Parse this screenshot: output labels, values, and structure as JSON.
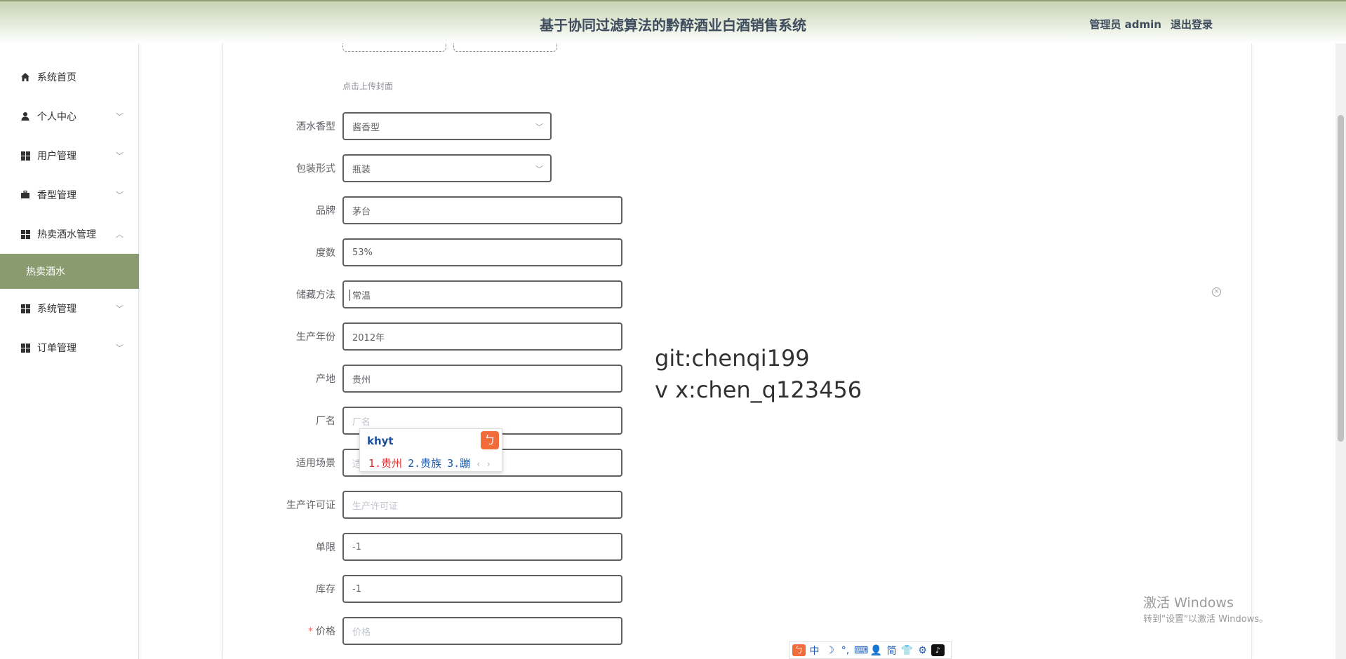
{
  "header": {
    "title": "基于协同过滤算法的黔醉酒业白酒销售系统",
    "user": "管理员 admin",
    "logout": "退出登录"
  },
  "sidebar": {
    "items": [
      {
        "label": "系统首页",
        "icon": "home-icon"
      },
      {
        "label": "个人中心",
        "icon": "user-icon",
        "arrow": "﹀"
      },
      {
        "label": "用户管理",
        "icon": "grid-icon",
        "arrow": "﹀"
      },
      {
        "label": "香型管理",
        "icon": "briefcase-icon",
        "arrow": "﹀"
      },
      {
        "label": "热卖酒水管理",
        "icon": "grid-icon",
        "arrow": "︿"
      },
      {
        "label": "系统管理",
        "icon": "grid-icon",
        "arrow": "﹀"
      },
      {
        "label": "订单管理",
        "icon": "grid-icon",
        "arrow": "﹀"
      }
    ],
    "active_sub": "热卖酒水"
  },
  "form": {
    "upload_hint": "点击上传封面",
    "fields": [
      {
        "label": "酒水香型",
        "value": "酱香型",
        "type": "select"
      },
      {
        "label": "包装形式",
        "value": "瓶装",
        "type": "select"
      },
      {
        "label": "品牌",
        "value": "茅台"
      },
      {
        "label": "度数",
        "value": "53%"
      },
      {
        "label": "储藏方法",
        "value": "常温"
      },
      {
        "label": "生产年份",
        "value": "2012年"
      },
      {
        "label": "产地",
        "value": "贵州"
      },
      {
        "label": "厂名",
        "placeholder": "厂名"
      },
      {
        "label": "适用场景",
        "placeholder": "适"
      },
      {
        "label": "生产许可证",
        "placeholder": "生产许可证"
      },
      {
        "label": "单限",
        "value": "-1"
      },
      {
        "label": "库存",
        "value": "-1"
      },
      {
        "label": "价格",
        "placeholder": "价格",
        "required": "*"
      }
    ]
  },
  "watermark": {
    "line1": "git:chenqi199",
    "line2": "v x:chen_q123456"
  },
  "ime": {
    "composition": "khyt",
    "candidates": [
      "1.贵州",
      "2.贵族",
      "3.蹦"
    ],
    "nav": "‹ ›"
  },
  "activation": {
    "title": "激活 Windows",
    "subtitle": "转到\"设置\"以激活 Windows。"
  },
  "ime_toolbar": [
    "中",
    "☽",
    "°,",
    "⌨",
    "👤",
    "简",
    "👕",
    "⚙"
  ],
  "colors": {
    "accent": "#8a9c6f",
    "header_top": "#c6d3b2",
    "ime_brand": "#f26b3a"
  }
}
